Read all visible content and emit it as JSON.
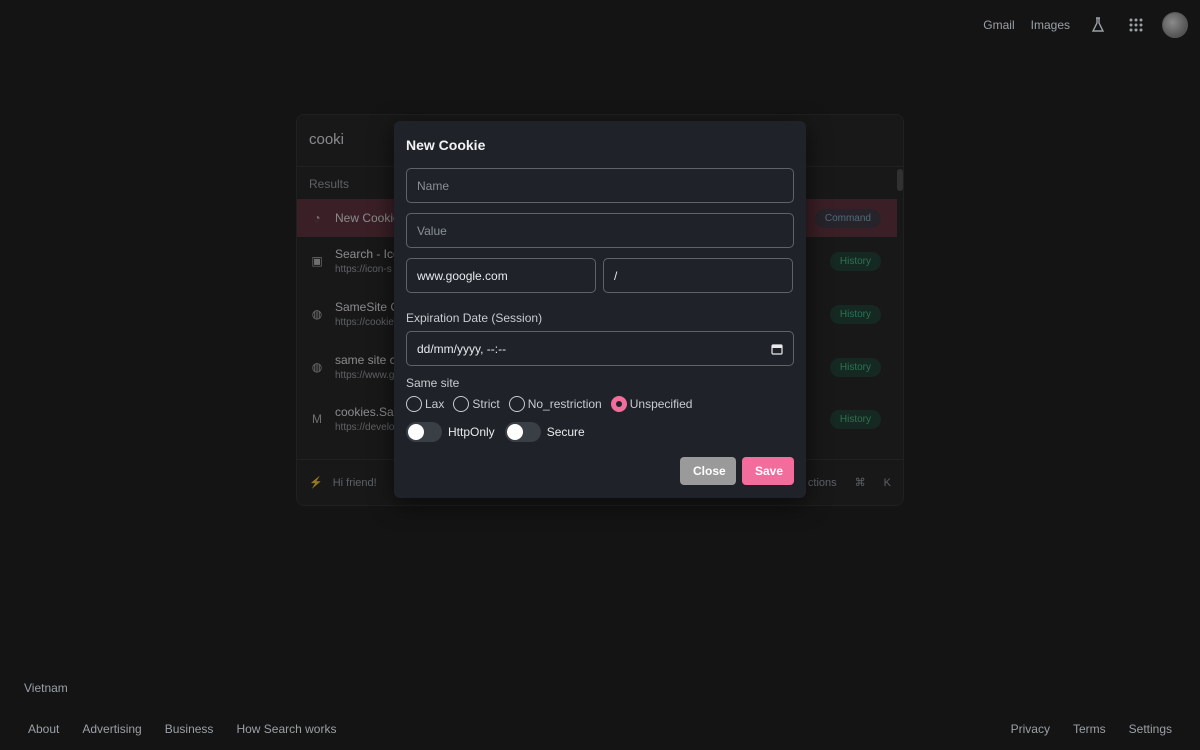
{
  "topbar": {
    "links": [
      "Gmail",
      "Images"
    ],
    "icons": [
      "labs-flask-icon",
      "apps-grid-icon"
    ]
  },
  "palette": {
    "query": "cooki",
    "results_label": "Results",
    "rows": [
      {
        "title": "New Cookie",
        "url": "",
        "badge": "Command",
        "icon": "cookie-icon"
      },
      {
        "title": "Search - Ico",
        "url": "https://icon-s",
        "badge": "History",
        "icon": "site-icon"
      },
      {
        "title": "SameSite C",
        "url": "https://cookie",
        "badge": "History",
        "icon": "globe-icon"
      },
      {
        "title": "same site c",
        "url": "https://www.g",
        "badge": "History",
        "icon": "globe-icon"
      },
      {
        "title": "cookies.Sar",
        "url": "https://develo",
        "badge": "History",
        "icon": "mdn-icon"
      }
    ],
    "footer_text": "Hi friend!",
    "footer_actions_text": "ctions",
    "footer_keys": [
      "⌘",
      "K"
    ]
  },
  "modal": {
    "title": "New Cookie",
    "name_placeholder": "Name",
    "value_placeholder": "Value",
    "domain_value": "www.google.com",
    "path_value": "/",
    "expiration_label": "Expiration Date (Session)",
    "date_placeholder": "dd/mm/yyyy, --:--",
    "samesite_label": "Same site",
    "samesite_options": [
      "Lax",
      "Strict",
      "No_restriction",
      "Unspecified"
    ],
    "samesite_selected": "Unspecified",
    "httponly_label": "HttpOnly",
    "secure_label": "Secure",
    "close_label": "Close",
    "save_label": "Save"
  },
  "footer": {
    "country": "Vietnam",
    "left_links": [
      "About",
      "Advertising",
      "Business",
      "How Search works"
    ],
    "right_links": [
      "Privacy",
      "Terms",
      "Settings"
    ]
  },
  "colors": {
    "accent": "#f26d9b",
    "modal_bg": "#1f2329",
    "page_bg": "#141414"
  }
}
